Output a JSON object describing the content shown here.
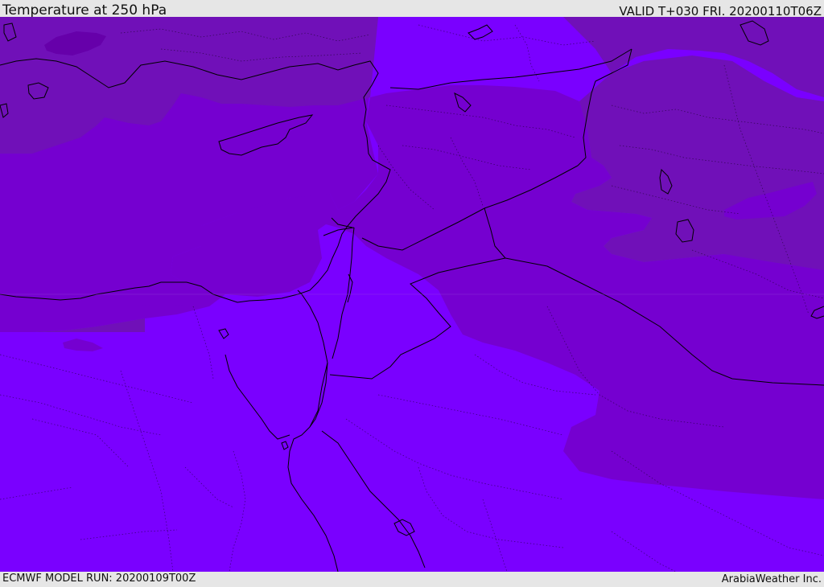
{
  "header": {
    "title": "Temperature at 250 hPa",
    "valid": "VALID T+030 FRI. 20200110T06Z"
  },
  "footer": {
    "model_run": "ECMWF MODEL RUN: 20200109T00Z",
    "credit": "ArabiaWeather Inc."
  },
  "colors": {
    "coldest": "#6600aa",
    "cold": "#7010b8",
    "mid": "#7500d0",
    "warm": "#7a00ff",
    "border": "#000000"
  }
}
